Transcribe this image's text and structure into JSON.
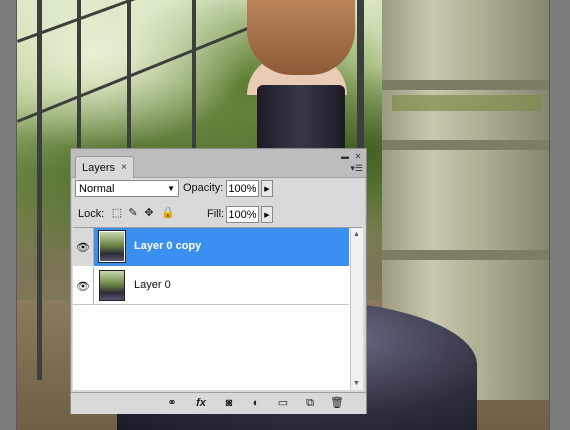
{
  "panel": {
    "tab_label": "Layers",
    "tab_close_glyph": "×",
    "minimize_glyph": "▬",
    "close_glyph": "✕",
    "menu_glyph": "▾☰",
    "blend_mode": "Normal",
    "opacity_label": "Opacity:",
    "opacity_value": "100%",
    "lock_label": "Lock:",
    "fill_label": "Fill:",
    "fill_value": "100%"
  },
  "lock_icons": [
    {
      "name": "lock-transparent-pixels-icon",
      "glyph": "⬚"
    },
    {
      "name": "lock-image-pixels-icon",
      "glyph": "✎"
    },
    {
      "name": "lock-position-icon",
      "glyph": "✥"
    },
    {
      "name": "lock-all-icon",
      "glyph": "🔒"
    }
  ],
  "layers": [
    {
      "name": "Layer 0 copy",
      "visible": true,
      "selected": true
    },
    {
      "name": "Layer 0",
      "visible": true,
      "selected": false
    }
  ],
  "footer_icons": [
    {
      "name": "link-layers-icon",
      "glyph": "⚭"
    },
    {
      "name": "layer-style-fx-icon",
      "glyph": "fx"
    },
    {
      "name": "add-mask-icon",
      "glyph": "◙"
    },
    {
      "name": "adjustment-layer-icon",
      "glyph": "◐"
    },
    {
      "name": "new-group-icon",
      "glyph": "▭"
    },
    {
      "name": "new-layer-icon",
      "glyph": "⧉"
    },
    {
      "name": "delete-layer-icon",
      "glyph": "🗑"
    }
  ],
  "colors": {
    "selection": "#3a8ff0",
    "panel_bg": "#d9d9d9"
  }
}
